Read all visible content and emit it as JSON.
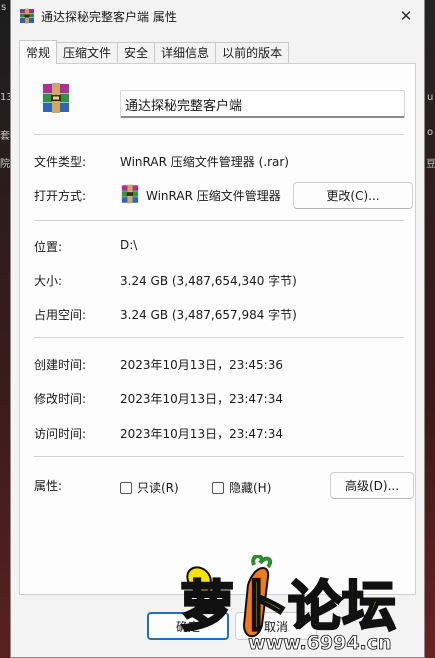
{
  "window": {
    "title": "通达探秘完整客户端 属性",
    "close_glyph": "✕"
  },
  "tabs": [
    {
      "label": "常规",
      "active": true
    },
    {
      "label": "压缩文件",
      "active": false
    },
    {
      "label": "安全",
      "active": false
    },
    {
      "label": "详细信息",
      "active": false
    },
    {
      "label": "以前的版本",
      "active": false
    }
  ],
  "file": {
    "name": "通达探秘完整客户端",
    "icon": "winrar-archive-icon"
  },
  "general": {
    "type_label": "文件类型:",
    "type_value": "WinRAR 压缩文件管理器 (.rar)",
    "opens_label": "打开方式:",
    "opens_value": "WinRAR 压缩文件管理器",
    "change_button": "更改(C)...",
    "location_label": "位置:",
    "location_value": "D:\\",
    "size_label": "大小:",
    "size_value": "3.24 GB (3,487,654,340 字节)",
    "disk_label": "占用空间:",
    "disk_value": "3.24 GB (3,487,657,984 字节)",
    "created_label": "创建时间:",
    "created_value": "2023年10月13日，23:45:36",
    "modified_label": "修改时间:",
    "modified_value": "2023年10月13日，23:47:34",
    "accessed_label": "访问时间:",
    "accessed_value": "2023年10月13日，23:47:34",
    "attr_label": "属性:",
    "readonly_label": "只读(R)",
    "hidden_label": "隐藏(H)",
    "advanced_button": "高级(D)..."
  },
  "footer": {
    "ok": "确定",
    "cancel": "取消"
  },
  "watermark": {
    "text": "萝卜论坛",
    "url": "www.6994.cn"
  },
  "background": {
    "edge_texts": [
      "s",
      "13",
      "套",
      "院",
      "u",
      "o",
      "豆"
    ]
  },
  "colors": {
    "accent": "#1f6fc5",
    "window_bg": "#f3f3f3",
    "watermark_fill": "#f6e400"
  }
}
